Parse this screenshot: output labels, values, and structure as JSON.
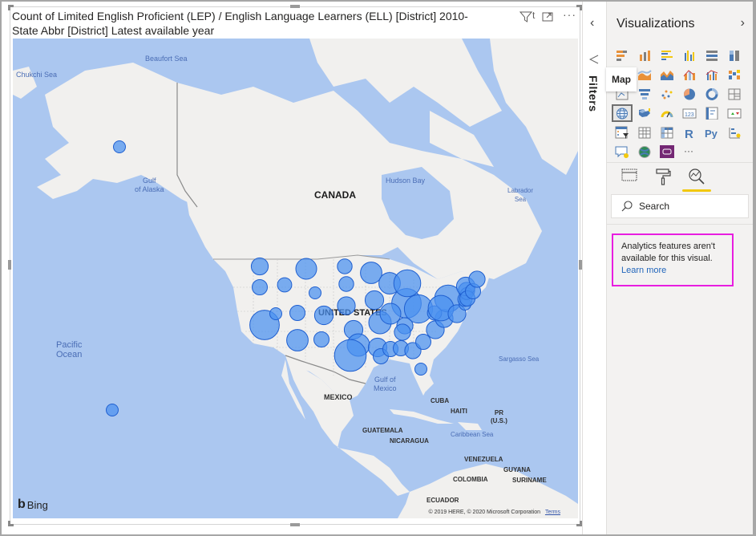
{
  "visual": {
    "title_line1": "Count of Limited English Proficient (LEP) / English Language Learners (ELL) [District] 2010-",
    "title_line2": "State Abbr [District] Latest available year",
    "icons": [
      "filter-icon",
      "focus-mode-icon",
      "more-options-icon"
    ]
  },
  "map": {
    "provider": "Bing",
    "copyright": "© 2019 HERE, © 2020 Microsoft Corporation",
    "terms_label": "Terms",
    "water_labels": [
      {
        "text": "Beaufort Sea"
      },
      {
        "text": "Chukchi Sea"
      },
      {
        "text": "Gulf\nof Alaska"
      },
      {
        "text": "Hudson Bay"
      },
      {
        "text": "Labrador\nSea"
      },
      {
        "text": "Pacific\nOcean"
      },
      {
        "text": "Gulf of\nMexico"
      },
      {
        "text": "Sargasso Sea"
      },
      {
        "text": "Caribbean Sea"
      }
    ],
    "country_labels": [
      "CANADA",
      "UNITED STATES",
      "MEXICO",
      "CUBA",
      "HAITI",
      "PR\n(U.S.)",
      "GUATEMALA",
      "NICARAGUA",
      "VENEZUELA",
      "GUYANA",
      "COLOMBIA",
      "SURINAME",
      "ECUADOR"
    ],
    "bubble_color": "#4a90f0",
    "bubble_stroke": "#1f5fd0",
    "bubbles": [
      {
        "region": "AK",
        "size": 1
      },
      {
        "region": "HI",
        "size": 1
      },
      {
        "region": "WA",
        "size": 2
      },
      {
        "region": "OR",
        "size": 1.6
      },
      {
        "region": "CA",
        "size": 6
      },
      {
        "region": "NV",
        "size": 1
      },
      {
        "region": "ID",
        "size": 1.4
      },
      {
        "region": "MT",
        "size": 3
      },
      {
        "region": "WY",
        "size": 1
      },
      {
        "region": "UT",
        "size": 1.6
      },
      {
        "region": "AZ",
        "size": 3.2
      },
      {
        "region": "NM",
        "size": 1.6
      },
      {
        "region": "CO",
        "size": 2.4
      },
      {
        "region": "ND",
        "size": 1.5
      },
      {
        "region": "SD",
        "size": 1.5
      },
      {
        "region": "NE",
        "size": 2.2
      },
      {
        "region": "KS",
        "size": 2.4
      },
      {
        "region": "OK",
        "size": 3.5
      },
      {
        "region": "TX",
        "size": 7
      },
      {
        "region": "MN",
        "size": 3.2
      },
      {
        "region": "IA",
        "size": 2.4
      },
      {
        "region": "MO",
        "size": 3.5
      },
      {
        "region": "AR",
        "size": 2.4
      },
      {
        "region": "LA",
        "size": 1.6
      },
      {
        "region": "WI",
        "size": 3.2
      },
      {
        "region": "IL",
        "size": 6
      },
      {
        "region": "MI",
        "size": 5
      },
      {
        "region": "IN",
        "size": 3
      },
      {
        "region": "OH",
        "size": 5.5
      },
      {
        "region": "KY",
        "size": 1.8
      },
      {
        "region": "TN",
        "size": 1.8
      },
      {
        "region": "MS",
        "size": 1.6
      },
      {
        "region": "AL",
        "size": 1.6
      },
      {
        "region": "GA",
        "size": 1.8
      },
      {
        "region": "FL",
        "size": 1
      },
      {
        "region": "SC",
        "size": 1.6
      },
      {
        "region": "NC",
        "size": 2.2
      },
      {
        "region": "VA",
        "size": 2.2
      },
      {
        "region": "WV",
        "size": 1.4
      },
      {
        "region": "PA",
        "size": 5
      },
      {
        "region": "NY",
        "size": 4.5
      },
      {
        "region": "NJ",
        "size": 2.2
      },
      {
        "region": "DE",
        "size": 1
      },
      {
        "region": "MD",
        "size": 1.4
      },
      {
        "region": "CT",
        "size": 1.8
      },
      {
        "region": "RI",
        "size": 1
      },
      {
        "region": "MA",
        "size": 2.4
      },
      {
        "region": "VT",
        "size": 1.6
      },
      {
        "region": "NH",
        "size": 1.6
      },
      {
        "region": "ME",
        "size": 1.8
      }
    ]
  },
  "filters_pane": {
    "label": "Filters",
    "collapse_icon": "chevron-left-icon"
  },
  "viz_pane": {
    "title": "Visualizations",
    "expand_icon": "chevron-right-icon",
    "tooltip": "Map",
    "selected_visual": "Map",
    "visual_types": [
      "Stacked bar chart",
      "Stacked column chart",
      "Clustered bar chart",
      "Clustered column chart",
      "100% stacked bar chart",
      "100% stacked column chart",
      "Line chart",
      "Area chart",
      "Stacked area chart",
      "Line and stacked column chart",
      "Line and clustered column chart",
      "Ribbon chart",
      "Waterfall chart",
      "Funnel",
      "Scatter chart",
      "Pie chart",
      "Donut chart",
      "Treemap",
      "Map",
      "Filled map",
      "Gauge",
      "Card",
      "Multi-row card",
      "KPI",
      "Slicer",
      "Table",
      "Matrix",
      "R script visual",
      "Python visual",
      "Key influencers",
      "Q&A",
      "ArcGIS Maps",
      "Power Apps",
      "More visuals"
    ],
    "tabs": [
      {
        "name": "Fields",
        "active": false
      },
      {
        "name": "Format",
        "active": false
      },
      {
        "name": "Analytics",
        "active": true
      }
    ],
    "search_placeholder": "Search",
    "analytics_message": "Analytics features aren't available for this visual.",
    "learn_more": "Learn more",
    "highlight_color": "#e81ee0",
    "accent_color": "#f2c80f"
  }
}
